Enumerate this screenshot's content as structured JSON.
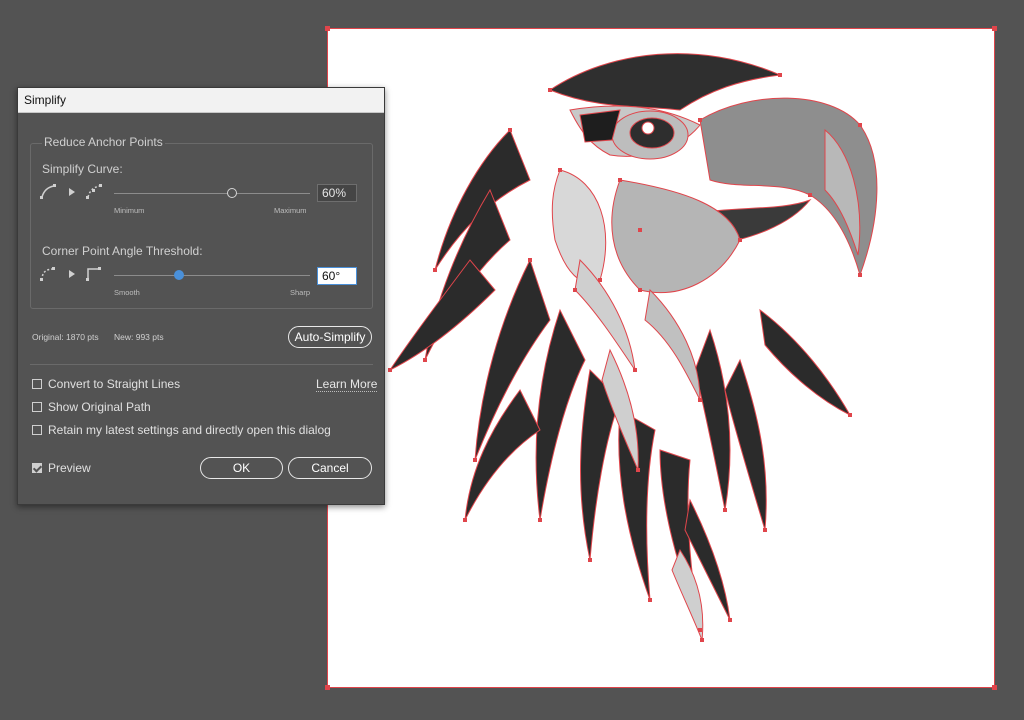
{
  "dialog": {
    "title": "Simplify",
    "group_title": "Reduce Anchor Points",
    "simplify_curve": {
      "label": "Simplify Curve:",
      "min_label": "Minimum",
      "max_label": "Maximum",
      "value": "60%",
      "level": 0.6
    },
    "corner_threshold": {
      "label": "Corner Point Angle Threshold:",
      "min_label": "Smooth",
      "max_label": "Sharp",
      "value": "60°",
      "level": 0.333
    },
    "original_points": "Original: 1870 pts",
    "new_points": "New: 993 pts",
    "auto_simplify_label": "Auto-Simplify",
    "options": [
      {
        "label": "Convert to Straight Lines",
        "checked": false
      },
      {
        "label": "Show Original Path",
        "checked": false
      },
      {
        "label": "Retain my latest settings and directly open this dialog",
        "checked": false
      }
    ],
    "learn_more_label": "Learn More",
    "preview_label": "Preview",
    "preview_checked": true,
    "ok_label": "OK",
    "cancel_label": "Cancel"
  },
  "icons": {
    "curve_before": "curve-smooth-icon",
    "arrow": "arrow-right-icon",
    "curve_after": "curve-simplified-icon",
    "corner_before": "corner-smooth-icon",
    "corner_after": "corner-sharp-icon"
  },
  "colors": {
    "workspace_bg": "#535353",
    "selection_red": "#e0454b",
    "slider_accent": "#4a90d9"
  }
}
